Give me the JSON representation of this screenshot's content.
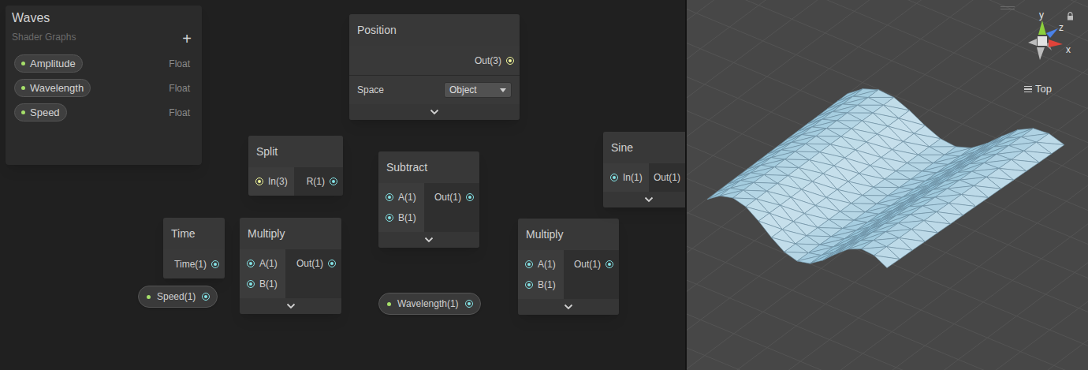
{
  "blackboard": {
    "title": "Waves",
    "subtitle": "Shader Graphs",
    "add_button": "+",
    "properties": [
      {
        "name": "Amplitude",
        "type": "Float",
        "exposed": true
      },
      {
        "name": "Wavelength",
        "type": "Float",
        "exposed": true
      },
      {
        "name": "Speed",
        "type": "Float",
        "exposed": true
      }
    ]
  },
  "nodes": [
    {
      "kind": "node",
      "title": "Position",
      "inputs": [],
      "outputs": [
        {
          "label": "Out(3)",
          "color": "#f2f79a",
          "connected": true
        }
      ],
      "setting": {
        "label": "Space",
        "value": "Object"
      }
    },
    {
      "kind": "node",
      "title": "Split",
      "inputs": [
        {
          "label": "In(3)",
          "color": "#f2f79a",
          "connected": true
        }
      ],
      "outputs": [
        {
          "label": "R(1)",
          "color": "#84e4e7",
          "connected": true
        }
      ]
    },
    {
      "kind": "node",
      "title": "Subtract",
      "inputs": [
        {
          "label": "A(1)",
          "color": "#84e4e7",
          "connected": true
        },
        {
          "label": "B(1)",
          "color": "#84e4e7",
          "connected": true
        }
      ],
      "outputs": [
        {
          "label": "Out(1)",
          "color": "#84e4e7",
          "connected": true
        }
      ]
    },
    {
      "kind": "node",
      "title": "Time",
      "inputs": [],
      "outputs": [
        {
          "label": "Time(1)",
          "color": "#84e4e7",
          "connected": true
        }
      ]
    },
    {
      "kind": "node",
      "title": "Multiply",
      "inputs": [
        {
          "label": "A(1)",
          "color": "#84e4e7",
          "connected": true
        },
        {
          "label": "B(1)",
          "color": "#84e4e7",
          "connected": true
        }
      ],
      "outputs": [
        {
          "label": "Out(1)",
          "color": "#84e4e7",
          "connected": true
        }
      ]
    },
    {
      "kind": "property",
      "label": "Speed(1)",
      "exposed": true,
      "color": "#84e4e7",
      "connected": true
    },
    {
      "kind": "property",
      "label": "Wavelength(1)",
      "exposed": true,
      "color": "#84e4e7",
      "connected": true
    },
    {
      "kind": "node",
      "title": "Multiply",
      "inputs": [
        {
          "label": "A(1)",
          "color": "#84e4e7",
          "connected": true
        },
        {
          "label": "B(1)",
          "color": "#84e4e7",
          "connected": true
        }
      ],
      "outputs": [
        {
          "label": "Out(1)",
          "color": "#84e4e7",
          "connected": true
        }
      ]
    },
    {
      "kind": "node",
      "title": "Sine",
      "inputs": [
        {
          "label": "In(1)",
          "color": "#84e4e7",
          "connected": true
        }
      ],
      "outputs": [
        {
          "label": "Out(1)",
          "color": "#84e4e7",
          "connected": true
        }
      ]
    }
  ],
  "edges": [
    {
      "from": {
        "node": 0,
        "port": "Out(3)"
      },
      "to": null,
      "offscreen": true,
      "color": "#f2f79a"
    },
    {
      "from": {
        "node": 0,
        "port": "Out(3)"
      },
      "to": {
        "node": 1,
        "port": "In(3)"
      },
      "offscreen": false,
      "color": "#b9bb7a"
    },
    {
      "from": {
        "node": 1,
        "port": "R(1)"
      },
      "to": {
        "node": 2,
        "port": "A(1)"
      },
      "offscreen": false,
      "color": "#84e4e7"
    },
    {
      "from": {
        "node": 4,
        "port": "Out(1)"
      },
      "to": {
        "node": 2,
        "port": "B(1)"
      },
      "offscreen": false,
      "color": "#84e4e7"
    },
    {
      "from": {
        "node": 3,
        "port": "Time(1)"
      },
      "to": {
        "node": 4,
        "port": "A(1)"
      },
      "offscreen": false,
      "color": "#84e4e7"
    },
    {
      "from": {
        "node": 5,
        "port": "Speed(1)"
      },
      "to": {
        "node": 4,
        "port": "B(1)"
      },
      "offscreen": false,
      "color": "#84e4e7"
    },
    {
      "from": {
        "node": 2,
        "port": "Out(1)"
      },
      "to": {
        "node": 7,
        "port": "A(1)"
      },
      "offscreen": false,
      "color": "#84e4e7"
    },
    {
      "from": {
        "node": 6,
        "port": "Wavelength(1)"
      },
      "to": {
        "node": 7,
        "port": "B(1)"
      },
      "offscreen": false,
      "color": "#84e4e7"
    },
    {
      "from": {
        "node": 7,
        "port": "Out(1)"
      },
      "to": {
        "node": 8,
        "port": "In(1)"
      },
      "offscreen": false,
      "color": "#84e4e7"
    }
  ],
  "scene": {
    "axes": [
      {
        "label": "y",
        "color": "#8cd03c"
      },
      {
        "label": "z",
        "color": "#4a82e8"
      },
      {
        "label": "x",
        "color": "#e0433a"
      }
    ],
    "view": "Top"
  }
}
